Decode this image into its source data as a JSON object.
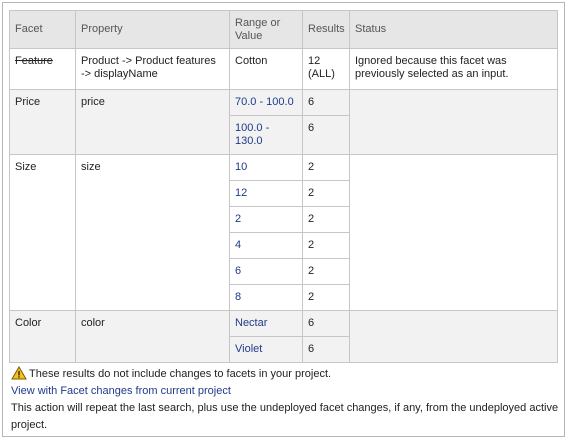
{
  "table": {
    "headers": [
      "Facet",
      "Property",
      "Range or Value",
      "Results",
      "Status"
    ],
    "header_lines": {
      "range": [
        "Range or",
        "Value"
      ]
    },
    "feature": {
      "facet": "Feature",
      "property_lines": [
        "Product -> Product features",
        "-> displayName"
      ],
      "value": "Cotton",
      "results_lines": [
        "12",
        "(ALL)"
      ],
      "status_lines": [
        "Ignored because this facet was",
        "previously selected as an input."
      ]
    },
    "price": {
      "facet": "Price",
      "property": "price",
      "rows": [
        {
          "value_lines": [
            "70.0 - 100.0"
          ],
          "results": "6"
        },
        {
          "value_lines": [
            "100.0 -",
            "130.0"
          ],
          "results": "6"
        }
      ]
    },
    "size": {
      "facet": "Size",
      "property": "size",
      "rows": [
        {
          "value": "10",
          "results": "2"
        },
        {
          "value": "12",
          "results": "2"
        },
        {
          "value": "2",
          "results": "2"
        },
        {
          "value": "4",
          "results": "2"
        },
        {
          "value": "6",
          "results": "2"
        },
        {
          "value": "8",
          "results": "2"
        }
      ]
    },
    "color": {
      "facet": "Color",
      "property": "color",
      "rows": [
        {
          "value": "Nectar",
          "results": "6"
        },
        {
          "value": "Violet",
          "results": "6"
        }
      ]
    }
  },
  "footer": {
    "warning": "These results do not include changes to facets in your project.",
    "link": "View with Facet changes from current project",
    "note": "This action will repeat the last search, plus use the undeployed facet changes, if any, from the undeployed active project."
  },
  "icons": {
    "warning": "warning-icon"
  },
  "colors": {
    "link": "#1f3a8a",
    "header_bg": "#e6e6e6",
    "row_bg": "#f2f2f2"
  }
}
